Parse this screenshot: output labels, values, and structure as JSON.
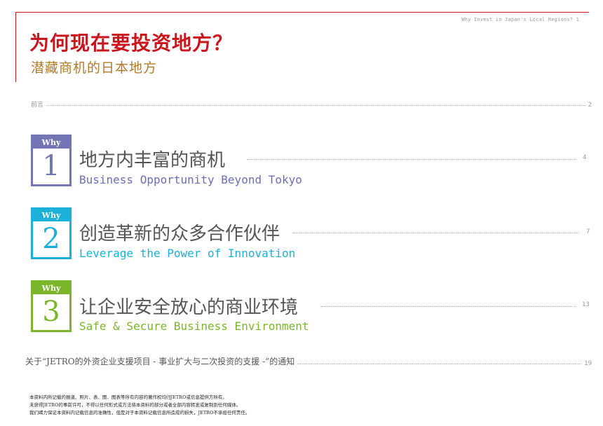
{
  "running_head": "Why Invest in Japan's Local Regions? 1",
  "title": "为何现在要投资地方？",
  "subtitle": "潜藏商机的日本地方",
  "toc": {
    "intro": {
      "label": "前言",
      "page": "2"
    },
    "sections": [
      {
        "why": "Why",
        "number": "1",
        "title_cn": "地方内丰富的商机",
        "title_en": "Business Opportunity Beyond Tokyo",
        "page": "4",
        "color": "#7476b4"
      },
      {
        "why": "Why",
        "number": "2",
        "title_cn": "创造革新的众多合作伙伴",
        "title_en": "Leverage the Power of Innovation",
        "page": "7",
        "color": "#1ab0d8"
      },
      {
        "why": "Why",
        "number": "3",
        "title_cn": "让企业安全放心的商业环境",
        "title_en": "Safe & Secure Business Environment",
        "page": "13",
        "color": "#7bb52a"
      }
    ],
    "notice": {
      "label": "关于“JETRO的外资企业支援项目 - 事业扩大与二次投资的支援 -”的通知",
      "page": "19"
    }
  },
  "footer": {
    "lines": [
      "本资料内所记载的报道、照片、表、图、图表等所有内容的著作权均归JETRO或信息提供方所有。",
      "未获得JETRO的事前许可，不得以任何形式或方法将本资料的部分或者全部内容转发或复制到任何媒体。",
      "我们竭力保证本资料内记载信息的准确性，但是对于本资料记载信息所造成的损失，JETRO不承担任何责任。"
    ]
  }
}
